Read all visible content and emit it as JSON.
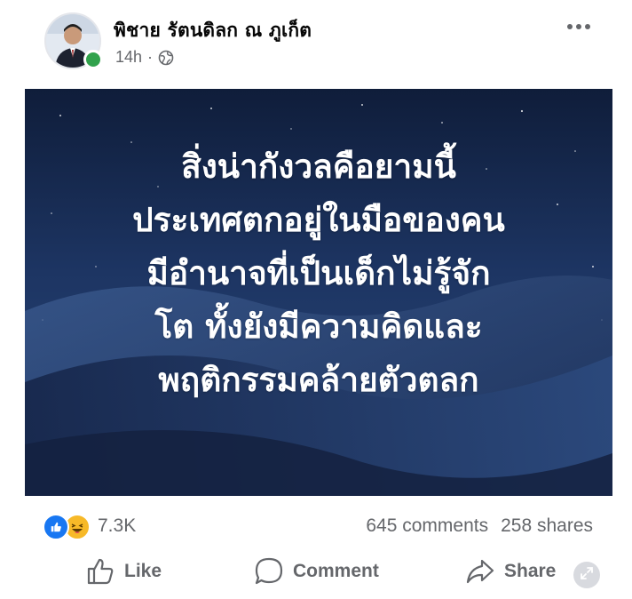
{
  "post": {
    "author_name": "พิชาย รัตนดิลก ณ ภูเก็ต",
    "timestamp": "14h",
    "meta_separator": "·",
    "audience_icon": "globe-icon",
    "online_color": "#31a24c"
  },
  "image": {
    "quote_lines": [
      "สิ่งน่ากังวลคือยามนี้",
      "ประเทศตกอยู่ในมือของคน",
      "มีอำนาจที่เป็นเด็กไม่รู้จัก",
      "โต ทั้งยังมีความคิดและ",
      "พฤติกรรมคล้ายตัวตลก"
    ],
    "background_theme": "night-sky-desert-dunes"
  },
  "reactions": {
    "icons": [
      "like-icon",
      "haha-icon"
    ],
    "count": "7.3K",
    "comments": "645 comments",
    "shares": "258 shares"
  },
  "actions": {
    "like_label": "Like",
    "comment_label": "Comment",
    "share_label": "Share"
  },
  "colors": {
    "text_primary": "#050505",
    "text_secondary": "#65676b",
    "like_blue": "#1877f2",
    "haha_yellow": "#f7b928"
  }
}
